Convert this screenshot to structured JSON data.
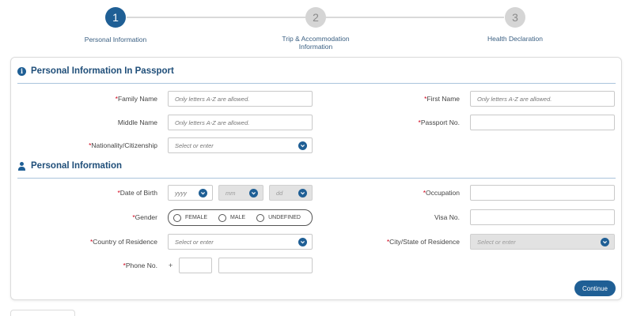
{
  "stepper": {
    "steps": [
      {
        "number": "1",
        "label": "Personal Information"
      },
      {
        "number": "2",
        "label_line1": "Trip & Accommodation",
        "label_line2": "Information"
      },
      {
        "number": "3",
        "label": "Health Declaration"
      }
    ]
  },
  "sections": {
    "passport_title": "Personal Information In Passport",
    "personal_title": "Personal Information"
  },
  "required_mark": "*",
  "form": {
    "family_name": {
      "label": "Family Name",
      "placeholder": "Only letters A-Z are allowed."
    },
    "first_name": {
      "label": "First Name",
      "placeholder": "Only letters A-Z are allowed."
    },
    "middle_name": {
      "label": "Middle Name",
      "placeholder": "Only letters A-Z are allowed."
    },
    "passport_no": {
      "label": "Passport No.",
      "value": ""
    },
    "nationality": {
      "label": "Nationality/Citizenship",
      "placeholder": "Select or enter"
    },
    "date_of_birth": {
      "label": "Date of Birth",
      "year": "yyyy",
      "month": "mm",
      "day": "dd"
    },
    "occupation": {
      "label": "Occupation",
      "value": ""
    },
    "gender": {
      "label": "Gender",
      "options": [
        "FEMALE",
        "MALE",
        "UNDEFINED"
      ]
    },
    "visa_no": {
      "label": "Visa No.",
      "value": ""
    },
    "country_of_residence": {
      "label": "Country of Residence",
      "placeholder": "Select or enter"
    },
    "city_state": {
      "label": "City/State of Residence",
      "placeholder": "Select or enter"
    },
    "phone": {
      "label": "Phone No.",
      "prefix": "+"
    }
  },
  "buttons": {
    "continue": "Continue"
  },
  "colors": {
    "primary": "#1f5f95",
    "required": "#d0021b",
    "section_text": "#1f4e79"
  }
}
